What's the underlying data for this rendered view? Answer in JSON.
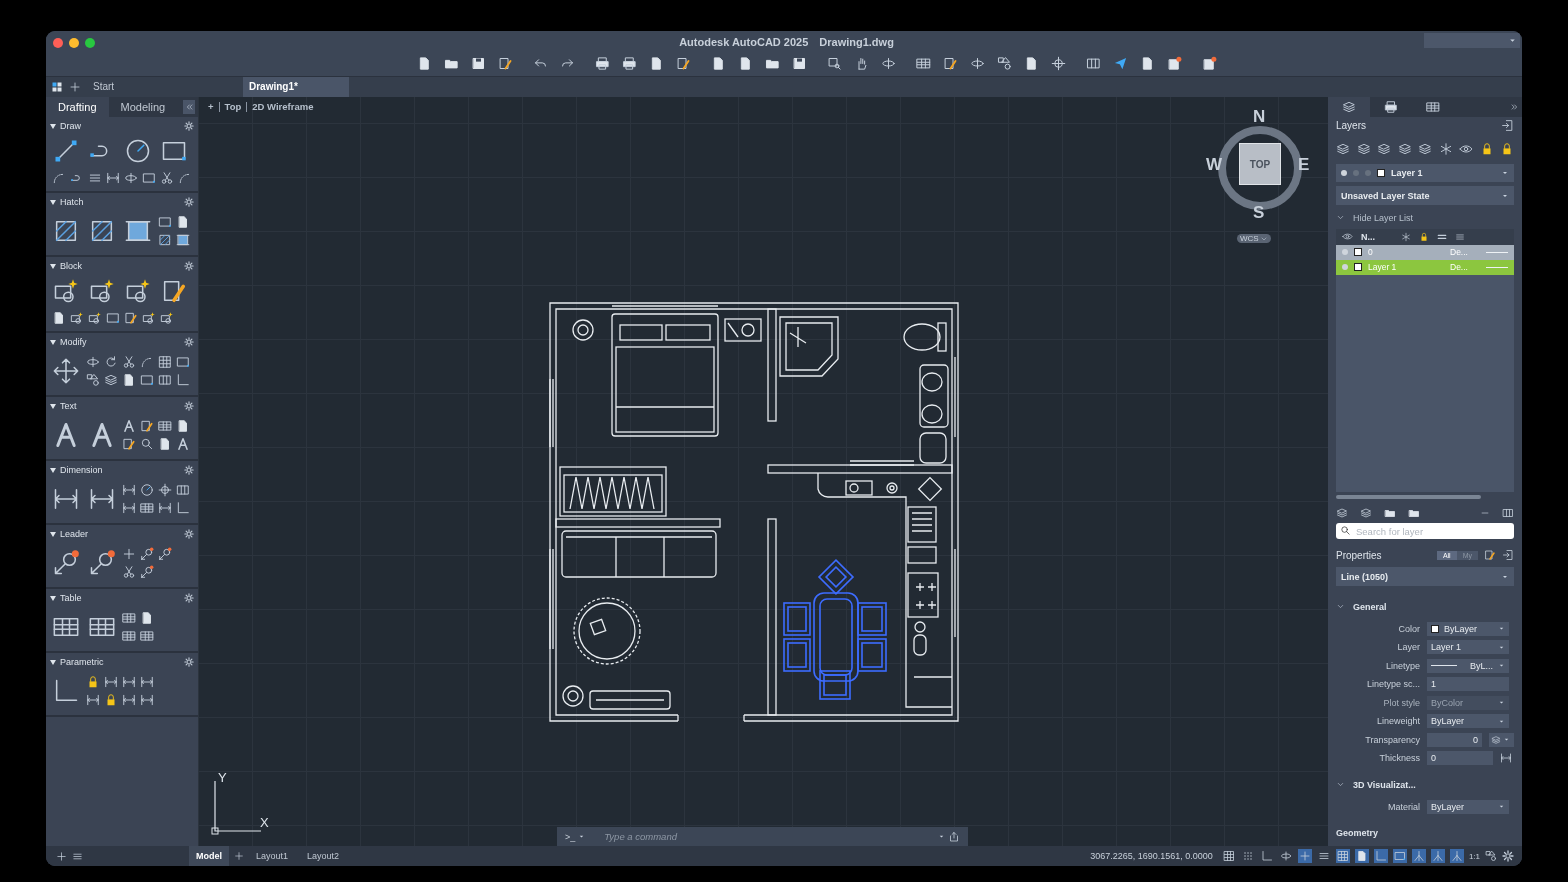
{
  "window": {
    "app_title": "Autodesk AutoCAD 2025",
    "document_title": "Drawing1.dwg"
  },
  "file_tabs": [
    {
      "label": "Start",
      "selected": false
    },
    {
      "label": "Drawing1*",
      "selected": true
    }
  ],
  "tool_palette": {
    "tabs": [
      {
        "label": "Drafting",
        "selected": true
      },
      {
        "label": "Modeling",
        "selected": false
      }
    ],
    "sections": [
      {
        "title": "Draw",
        "expanded": true
      },
      {
        "title": "Hatch",
        "expanded": true
      },
      {
        "title": "Block",
        "expanded": true
      },
      {
        "title": "Modify",
        "expanded": true
      },
      {
        "title": "Text",
        "expanded": true
      },
      {
        "title": "Dimension",
        "expanded": true
      },
      {
        "title": "Leader",
        "expanded": true
      },
      {
        "title": "Table",
        "expanded": true
      },
      {
        "title": "Parametric",
        "expanded": true
      }
    ]
  },
  "viewport": {
    "controls": [
      "+",
      "Top",
      "2D Wireframe"
    ],
    "viewcube": {
      "north": "N",
      "west": "W",
      "east": "E",
      "south": "S",
      "face": "TOP",
      "ucs_menu": "WCS"
    },
    "ucs_axes": {
      "x": "X",
      "y": "Y"
    }
  },
  "command_line": {
    "prompt": ">_",
    "placeholder": "Type a command"
  },
  "layers": {
    "panel_tabs": [
      {
        "selected": true
      },
      {
        "selected": false
      },
      {
        "selected": false
      }
    ],
    "title": "Layers",
    "current_layer": "Layer 1",
    "layer_state": "Unsaved Layer State",
    "list_toggle": {
      "label": "Hide Layer List",
      "expanded": true
    },
    "name_column": "N...",
    "rows": [
      {
        "name": "0",
        "description": "De...",
        "selected": false
      },
      {
        "name": "Layer 1",
        "description": "De...",
        "selected": true
      }
    ],
    "search": {
      "placeholder": "Search for layer"
    }
  },
  "properties": {
    "title": "Properties",
    "filters": [
      {
        "label": "All",
        "selected": true
      },
      {
        "label": "My",
        "selected": false
      }
    ],
    "selection": "Line (1050)",
    "sections": [
      {
        "title": "General",
        "expanded": true,
        "rows": [
          {
            "label": "Color",
            "value": "ByLayer",
            "kind": "color",
            "disabled": false
          },
          {
            "label": "Layer",
            "value": "Layer 1",
            "kind": "dropdown",
            "disabled": false
          },
          {
            "label": "Linetype",
            "value": "ByL...",
            "kind": "linetype",
            "disabled": false
          },
          {
            "label": "Linetype sc...",
            "value": "1",
            "kind": "text",
            "disabled": false
          },
          {
            "label": "Plot style",
            "value": "ByColor",
            "kind": "dropdown",
            "disabled": true
          },
          {
            "label": "Lineweight",
            "value": "ByLayer",
            "kind": "dropdown",
            "disabled": false
          },
          {
            "label": "Transparency",
            "value": "0",
            "kind": "transparency",
            "disabled": false
          },
          {
            "label": "Thickness",
            "value": "0",
            "kind": "thickness",
            "disabled": false
          }
        ]
      },
      {
        "title": "3D Visualizat...",
        "expanded": true,
        "rows": [
          {
            "label": "Material",
            "value": "ByLayer",
            "kind": "dropdown",
            "disabled": false
          }
        ]
      },
      {
        "title": "Geometry"
      }
    ]
  },
  "status_bar": {
    "layouts": [
      {
        "label": "Model",
        "selected": true
      },
      {
        "label": "Layout1",
        "selected": false
      },
      {
        "label": "Layout2",
        "selected": false
      }
    ],
    "coordinates": "3067.2265, 1690.1561, 0.0000",
    "annotation_scale": "1:1"
  }
}
